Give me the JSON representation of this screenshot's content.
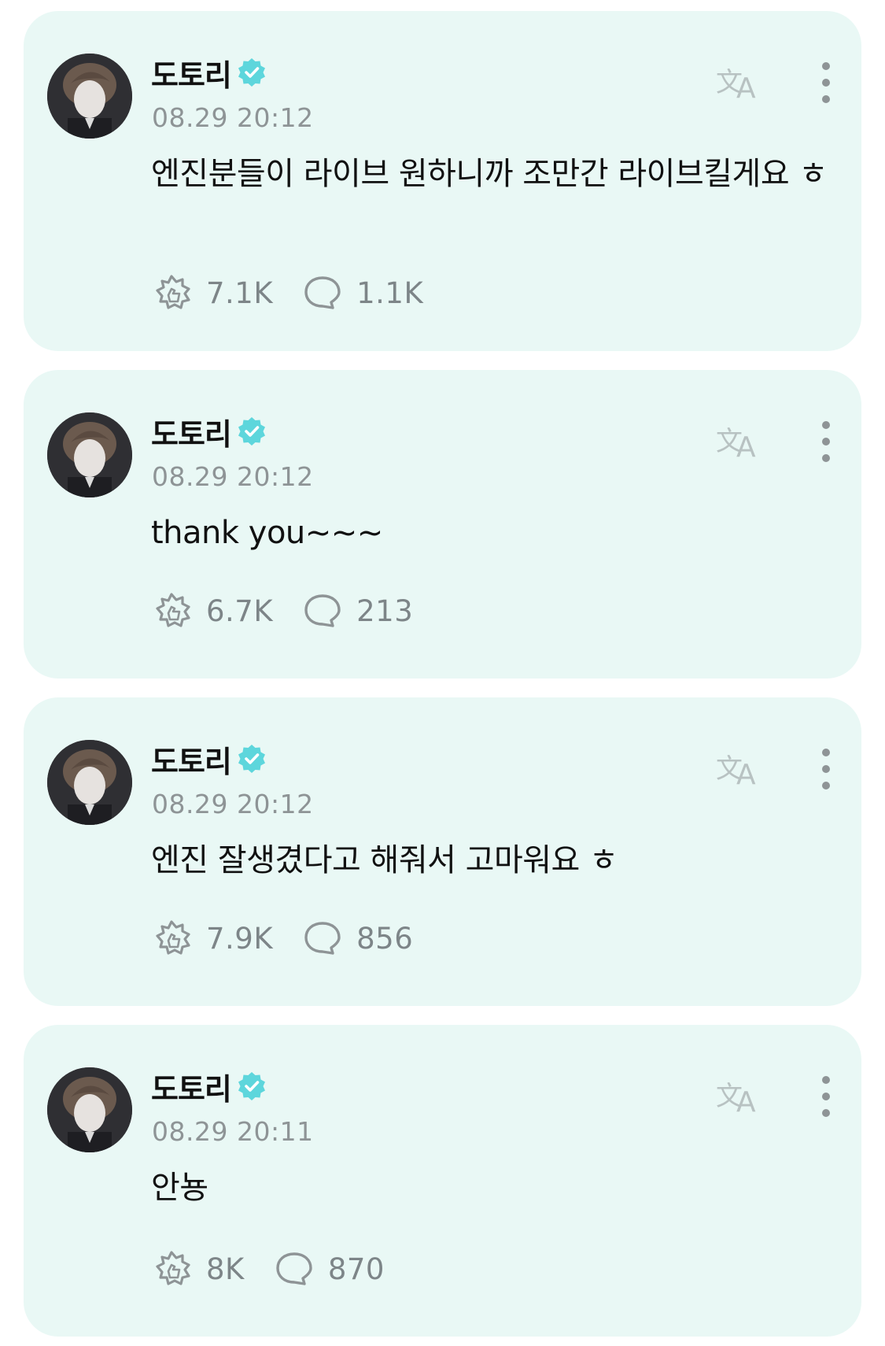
{
  "colors": {
    "card_background": "#e9f8f5",
    "verified_badge": "#5dd6dc",
    "muted_text": "#8e9496",
    "primary_text": "#111111"
  },
  "icons": {
    "translate": "translate-icon",
    "more": "more-vertical-icon",
    "like": "thumb-burst-icon",
    "comment": "speech-bubble-icon",
    "verified": "verified-badge-icon"
  },
  "posts": [
    {
      "author": "도토리",
      "time": "08.29 20:12",
      "text": "엔진분들이 라이브 원하니까 조만간 라이브킬게요 ㅎ",
      "likes": "7.1K",
      "comments": "1.1K"
    },
    {
      "author": "도토리",
      "time": "08.29 20:12",
      "text": "thank you~~~",
      "likes": "6.7K",
      "comments": "213"
    },
    {
      "author": "도토리",
      "time": "08.29 20:12",
      "text": "엔진 잘생겼다고 해줘서 고마워요 ㅎ",
      "likes": "7.9K",
      "comments": "856"
    },
    {
      "author": "도토리",
      "time": "08.29 20:11",
      "text": "안뇽",
      "likes": "8K",
      "comments": "870"
    }
  ]
}
